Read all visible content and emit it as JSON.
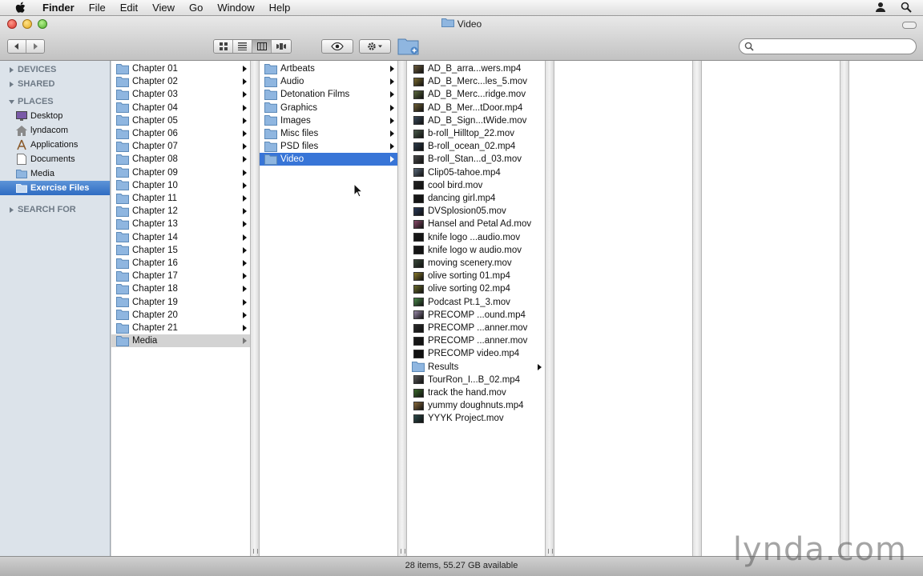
{
  "menubar": {
    "app_name": "Finder",
    "items": [
      "File",
      "Edit",
      "View",
      "Go",
      "Window",
      "Help"
    ]
  },
  "window": {
    "title": "Video"
  },
  "sidebar": {
    "devices": "DEVICES",
    "shared": "SHARED",
    "places": "PLACES",
    "search_for": "SEARCH FOR",
    "places_items": [
      {
        "label": "Desktop",
        "icon": "desktop-icon"
      },
      {
        "label": "lyndacom",
        "icon": "home-icon"
      },
      {
        "label": "Applications",
        "icon": "applications-icon"
      },
      {
        "label": "Documents",
        "icon": "documents-icon"
      },
      {
        "label": "Media",
        "icon": "folder-icon"
      },
      {
        "label": "Exercise Files",
        "icon": "folder-icon",
        "selected": true
      }
    ]
  },
  "columns": {
    "col1": [
      "Chapter 01",
      "Chapter 02",
      "Chapter 03",
      "Chapter 04",
      "Chapter 05",
      "Chapter 06",
      "Chapter 07",
      "Chapter 08",
      "Chapter 09",
      "Chapter 10",
      "Chapter 11",
      "Chapter 12",
      "Chapter 13",
      "Chapter 14",
      "Chapter 15",
      "Chapter 16",
      "Chapter 17",
      "Chapter 18",
      "Chapter 19",
      "Chapter 20",
      "Chapter 21",
      "Media"
    ],
    "col1_selected": "Media",
    "col2": [
      "Artbeats",
      "Audio",
      "Detonation Films",
      "Graphics",
      "Images",
      "Misc files",
      "PSD files",
      "Video"
    ],
    "col2_selected": "Video",
    "col3": [
      {
        "name": "AD_B_arra...wers.mp4",
        "type": "video",
        "color": "#6b5a3a"
      },
      {
        "name": "AD_B_Merc...les_5.mov",
        "type": "video",
        "color": "#7a6a2e"
      },
      {
        "name": "AD_B_Merc...ridge.mov",
        "type": "video",
        "color": "#5c6a3e"
      },
      {
        "name": "AD_B_Mer...tDoor.mp4",
        "type": "video",
        "color": "#6e5e34"
      },
      {
        "name": "AD_B_Sign...tWide.mov",
        "type": "video",
        "color": "#3a4a5a"
      },
      {
        "name": "b-roll_Hilltop_22.mov",
        "type": "video",
        "color": "#4a5a4a"
      },
      {
        "name": "B-roll_ocean_02.mp4",
        "type": "video",
        "color": "#2a3a4a"
      },
      {
        "name": "B-roll_Stan...d_03.mov",
        "type": "video",
        "color": "#4a4a4a"
      },
      {
        "name": "Clip05-tahoe.mp4",
        "type": "video",
        "color": "#5a6a7a"
      },
      {
        "name": "cool bird.mov",
        "type": "video",
        "color": "#222222"
      },
      {
        "name": "dancing girl.mp4",
        "type": "video",
        "color": "#1a1a1a"
      },
      {
        "name": "DVSplosion05.mov",
        "type": "video",
        "color": "#2a3a5a"
      },
      {
        "name": "Hansel and Petal Ad.mov",
        "type": "video",
        "color": "#8a4a6a"
      },
      {
        "name": "knife logo ...audio.mov",
        "type": "video",
        "color": "#1a1a1a"
      },
      {
        "name": "knife logo w audio.mov",
        "type": "video",
        "color": "#1a1a1a"
      },
      {
        "name": "moving scenery.mov",
        "type": "video",
        "color": "#3a4a3a"
      },
      {
        "name": "olive sorting 01.mp4",
        "type": "video",
        "color": "#8a7a2a"
      },
      {
        "name": "olive sorting 02.mp4",
        "type": "video",
        "color": "#6a6a2a"
      },
      {
        "name": "Podcast Pt.1_3.mov",
        "type": "video",
        "color": "#4a8a4a"
      },
      {
        "name": "PRECOMP ...ound.mp4",
        "type": "video",
        "color": "#9a8aaa"
      },
      {
        "name": "PRECOMP ...anner.mov",
        "type": "video",
        "color": "#2a2a2a"
      },
      {
        "name": "PRECOMP ...anner.mov",
        "type": "video",
        "color": "#1a1a1a"
      },
      {
        "name": "PRECOMP video.mp4",
        "type": "video",
        "color": "#111111"
      },
      {
        "name": "Results",
        "type": "folder",
        "color": "#8fb6e0"
      },
      {
        "name": "TourRon_I...B_02.mp4",
        "type": "video",
        "color": "#5a5a5a"
      },
      {
        "name": "track the hand.mov",
        "type": "video",
        "color": "#3a6a2a"
      },
      {
        "name": "yummy doughnuts.mp4",
        "type": "video",
        "color": "#8a6a3a"
      },
      {
        "name": "YYYK Project.mov",
        "type": "video",
        "color": "#2a4a4a"
      }
    ]
  },
  "status": {
    "text": "28 items, 55.27 GB available"
  },
  "watermark": "lynda.com",
  "colors": {
    "selection": "#3875d7",
    "sidebar_bg": "#dce3ea",
    "folder": "#8fb6e0"
  }
}
